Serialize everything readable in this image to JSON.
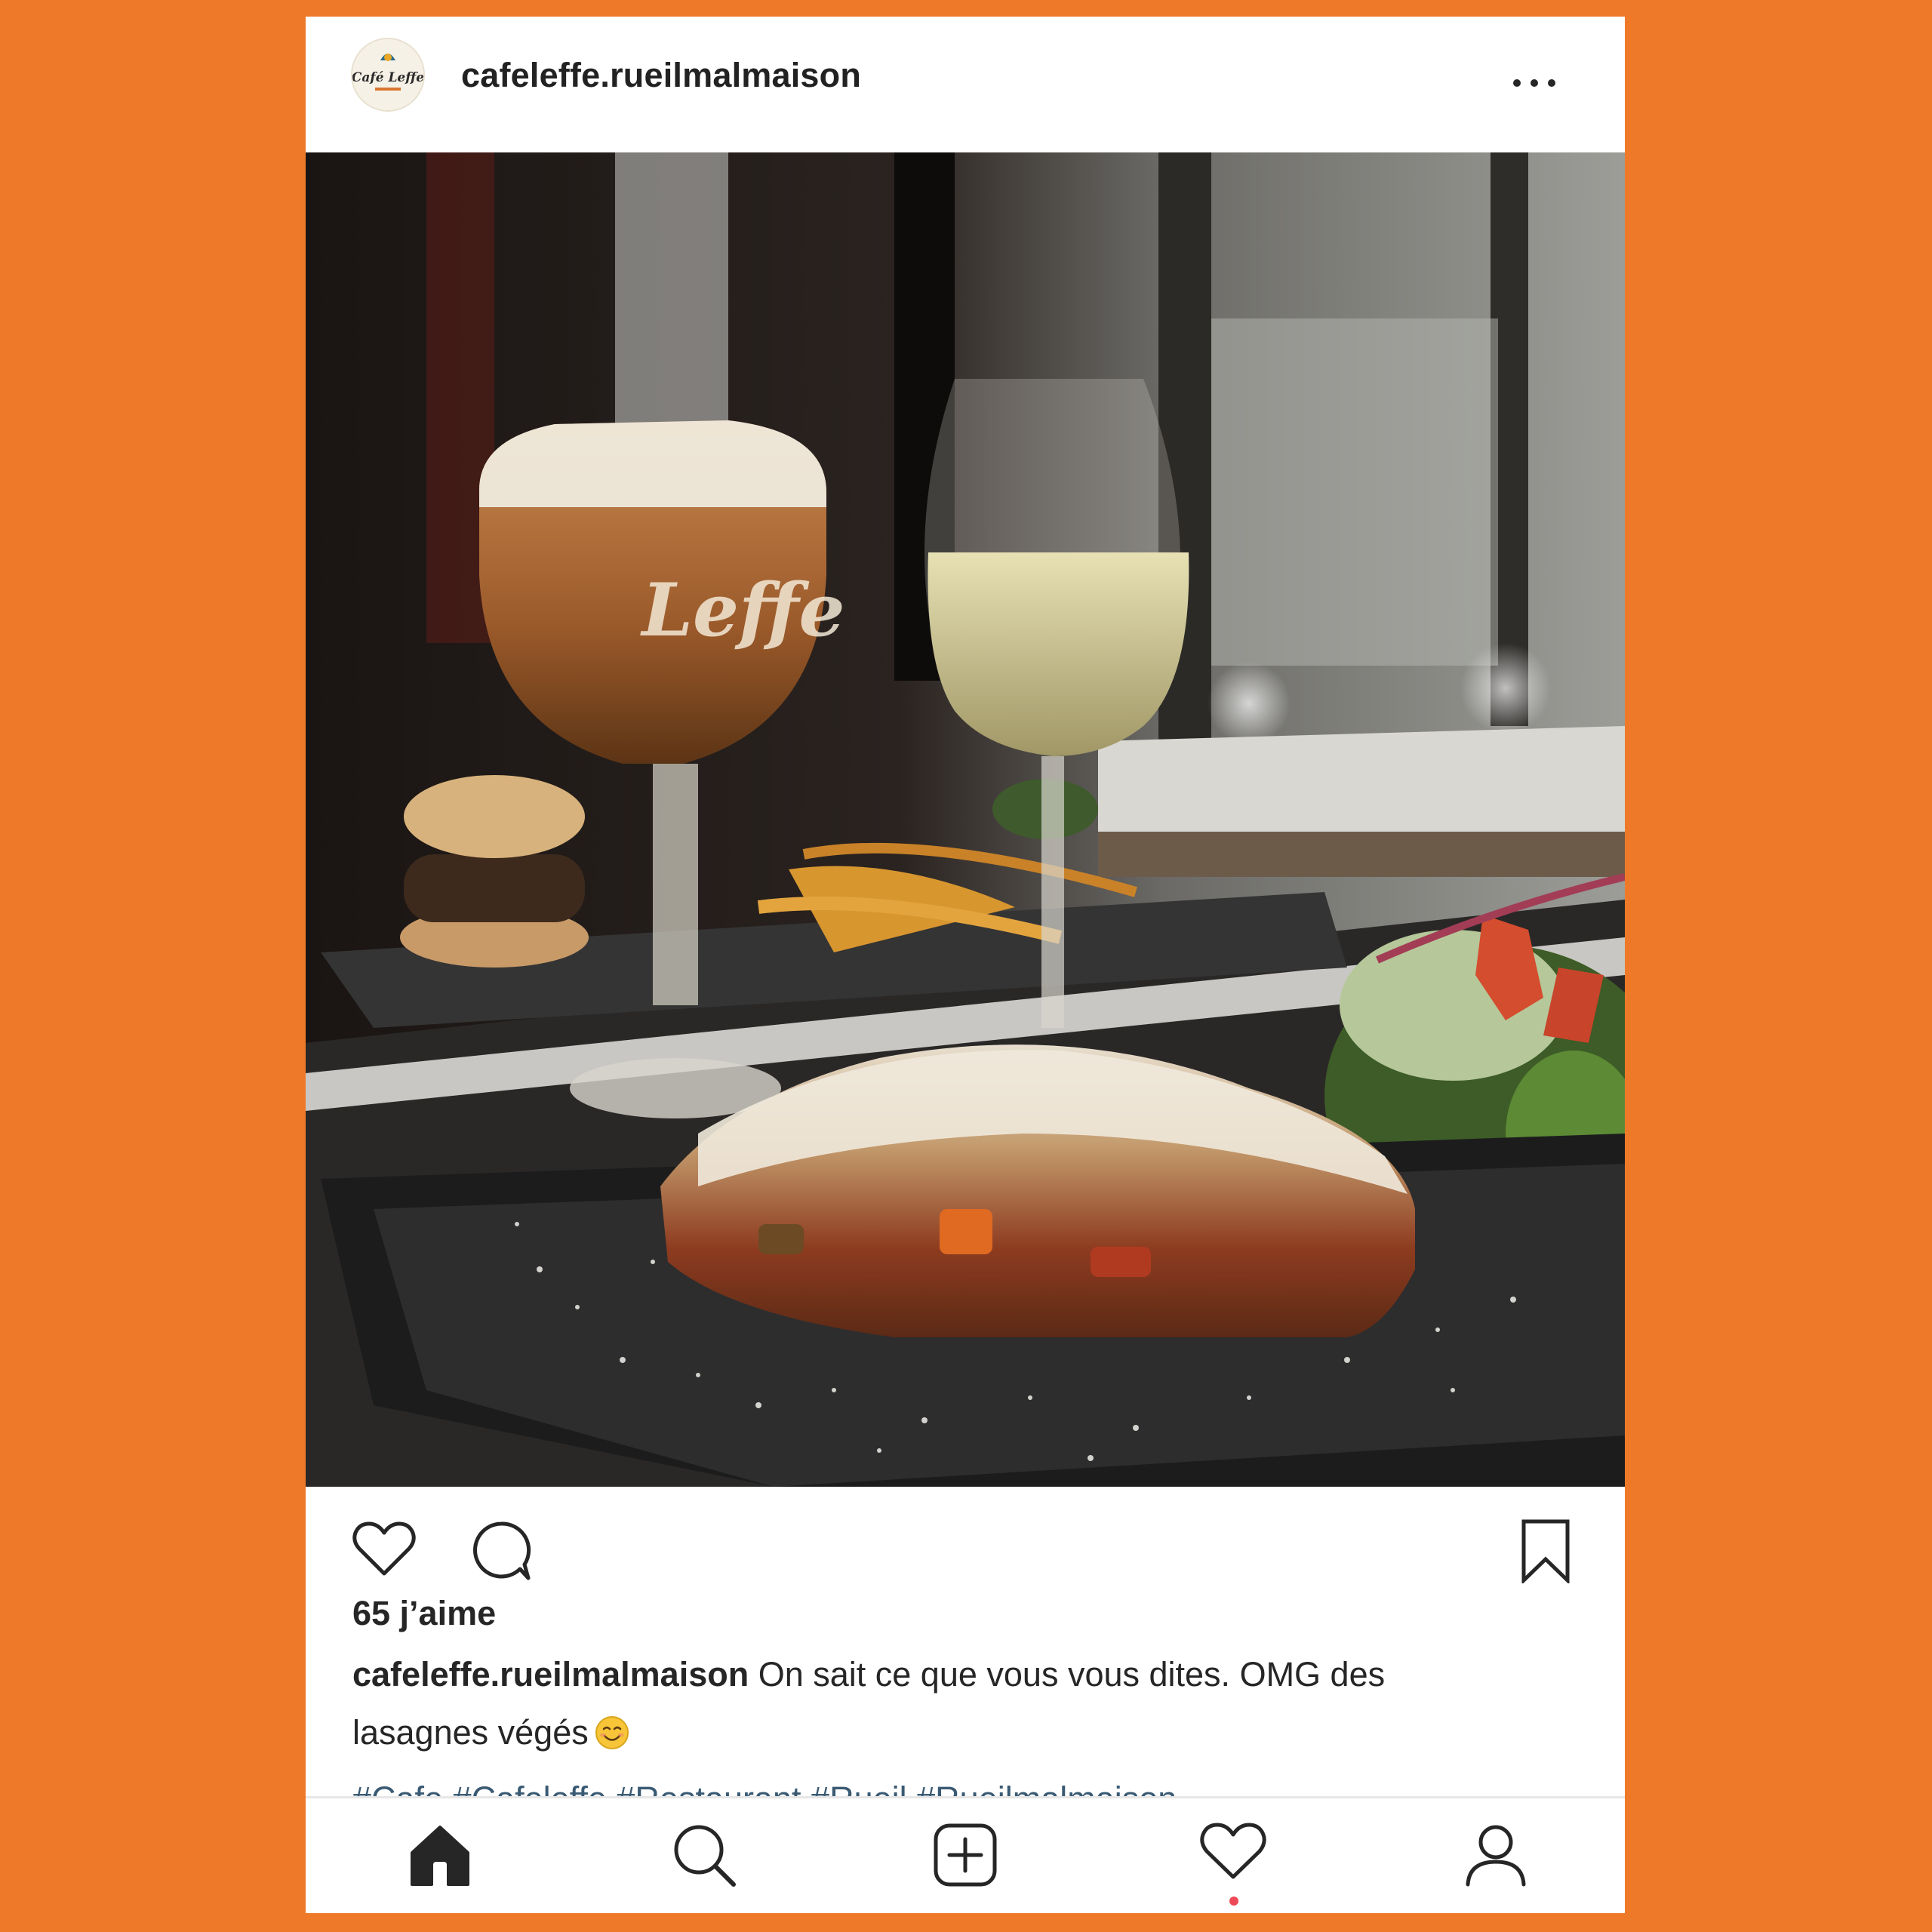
{
  "post": {
    "username": "cafeleffe.rueilmalmaison",
    "avatar_logo_text": "Café Leffe",
    "photo_glass_text": "Leffe",
    "likes_text": "65 j’aime",
    "caption_user": "cafeleffe.rueilmalmaison",
    "caption_text": " On sait ce que vous vous dites. OMG des lasagnes végés",
    "caption_emoji": "smiling-face-emoji",
    "hashtags": "#Cafe #Cafeleffe #Restaurant #Rueil #Rueilmalmaison"
  },
  "icons": {
    "more": "more-options-icon",
    "like": "heart-icon",
    "comment": "comment-icon",
    "save": "bookmark-icon"
  },
  "nav": {
    "items": [
      "home-icon",
      "search-icon",
      "new-post-icon",
      "activity-heart-icon",
      "profile-icon"
    ],
    "notification_dot": true
  },
  "colors": {
    "background": "#ee7a29",
    "card": "#ffffff",
    "hashtag": "#3a5a73",
    "notification": "#ed4956"
  }
}
